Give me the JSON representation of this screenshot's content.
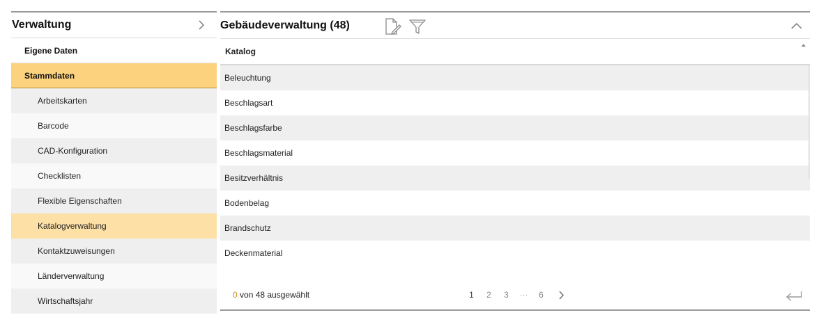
{
  "sidebar": {
    "title": "Verwaltung",
    "items": [
      {
        "label": "Eigene Daten"
      },
      {
        "label": "Stammdaten"
      }
    ],
    "subitems": [
      {
        "label": "Arbeitskarten"
      },
      {
        "label": "Barcode"
      },
      {
        "label": "CAD-Konfiguration"
      },
      {
        "label": "Checklisten"
      },
      {
        "label": "Flexible Eigenschaften"
      },
      {
        "label": "Katalogverwaltung"
      },
      {
        "label": "Kontaktzuweisungen"
      },
      {
        "label": "Länderverwaltung"
      },
      {
        "label": "Wirtschaftsjahr"
      }
    ]
  },
  "panel": {
    "title": "Gebäudeverwaltung (48)",
    "column_header": "Katalog",
    "rows": [
      "Beleuchtung",
      "Beschlagsart",
      "Beschlagsfarbe",
      "Beschlagsmaterial",
      "Besitzverhältnis",
      "Bodenbelag",
      "Brandschutz",
      "Deckenmaterial"
    ],
    "footer": {
      "selected_count": "0",
      "selected_suffix": " von 48 ausgewählt",
      "pages": [
        "1",
        "2",
        "3",
        "···",
        "6"
      ]
    }
  },
  "colors": {
    "active_section": "#fcd27e",
    "active_subitem": "#fde0a6",
    "row_stripe": "#efefef",
    "selected_count": "#d08a1a"
  },
  "icons": {
    "sidebar_toggle": "chevron-right-icon",
    "edit": "document-edit-icon",
    "filter": "funnel-icon",
    "collapse": "chevron-up-icon",
    "sort": "sort-asc-icon",
    "next_page": "chevron-right-icon",
    "return": "return-arrow-icon"
  }
}
